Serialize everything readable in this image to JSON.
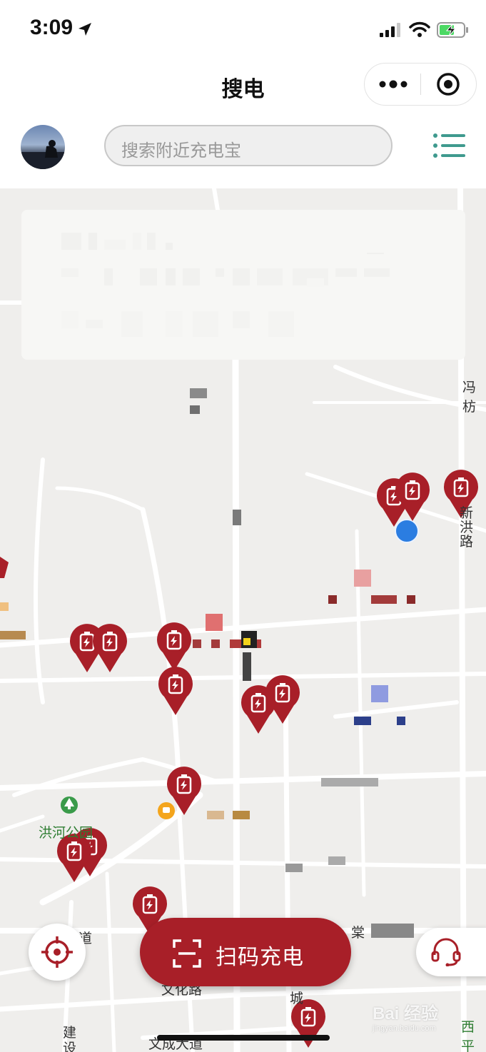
{
  "status_bar": {
    "time": "3:09"
  },
  "nav": {
    "title": "搜电",
    "more_icon": "more-dots-icon",
    "close_icon": "close-circle-icon"
  },
  "search": {
    "placeholder": "搜索附近充电宝"
  },
  "map": {
    "labels": {
      "fengshu": "冯枋",
      "new_hong": "新",
      "hong": "洪",
      "lu": "路",
      "park": "洪河公园",
      "dao": "道",
      "tang": "棠",
      "wenhua": "文化路",
      "cheng": "城",
      "jian": "建",
      "she": "设",
      "wencheng": "文成大道",
      "xiping": "西平"
    },
    "pin_icon": "power-bank-icon",
    "colors": {
      "pin": "#a81f28",
      "user_dot": "#2b7de1",
      "park": "#2e7d32"
    }
  },
  "actions": {
    "scan_label": "扫码充电",
    "locate_icon": "crosshair-icon",
    "service_icon": "headset-icon"
  },
  "watermark": {
    "text": "Bai 经验",
    "sub": "jingyan.baidu.com"
  }
}
